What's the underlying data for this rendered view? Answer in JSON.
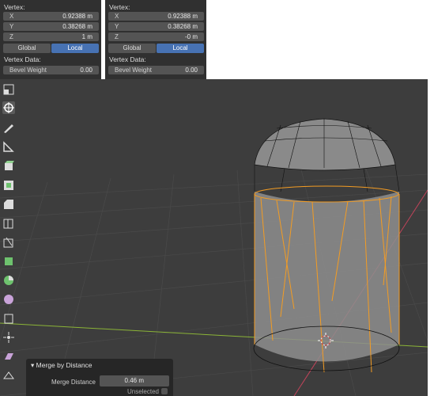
{
  "vertex_panels": [
    {
      "header": "Vertex:",
      "fields": [
        {
          "label": "X",
          "value": "0.92388 m"
        },
        {
          "label": "Y",
          "value": "0.38268 m"
        },
        {
          "label": "Z",
          "value": "1 m"
        }
      ],
      "space_global": "Global",
      "space_local": "Local",
      "data_header": "Vertex Data:",
      "bevel": {
        "label": "Bevel Weight",
        "value": "0.00"
      }
    },
    {
      "header": "Vertex:",
      "fields": [
        {
          "label": "X",
          "value": "0.92388 m"
        },
        {
          "label": "Y",
          "value": "0.38268 m"
        },
        {
          "label": "Z",
          "value": "-0 m"
        }
      ],
      "space_global": "Global",
      "space_local": "Local",
      "data_header": "Vertex Data:",
      "bevel": {
        "label": "Bevel Weight",
        "value": "0.00"
      }
    }
  ],
  "operator_panel": {
    "title": "Merge by Distance",
    "merge_distance_label": "Merge Distance",
    "merge_distance_value": "0.46 m",
    "unselected_label": "Unselected",
    "unselected_checked": false
  },
  "colors": {
    "panel_bg": "#303030",
    "viewport_bg": "#3d3d3d",
    "accent": "#4772b3",
    "selection": "#f39c23",
    "x_axis": "#c2435a",
    "y_axis": "#8bb437"
  },
  "toolbar_icons": [
    "select-box-icon",
    "cursor-icon",
    "annotate-icon",
    "measure-icon",
    "extrude-icon",
    "inset-icon",
    "bevel-icon",
    "loop-cut-icon",
    "knife-icon",
    "poly-build-icon",
    "spin-icon",
    "smooth-icon",
    "edge-slide-icon",
    "shrink-fatten-icon",
    "shear-icon",
    "rip-icon"
  ]
}
